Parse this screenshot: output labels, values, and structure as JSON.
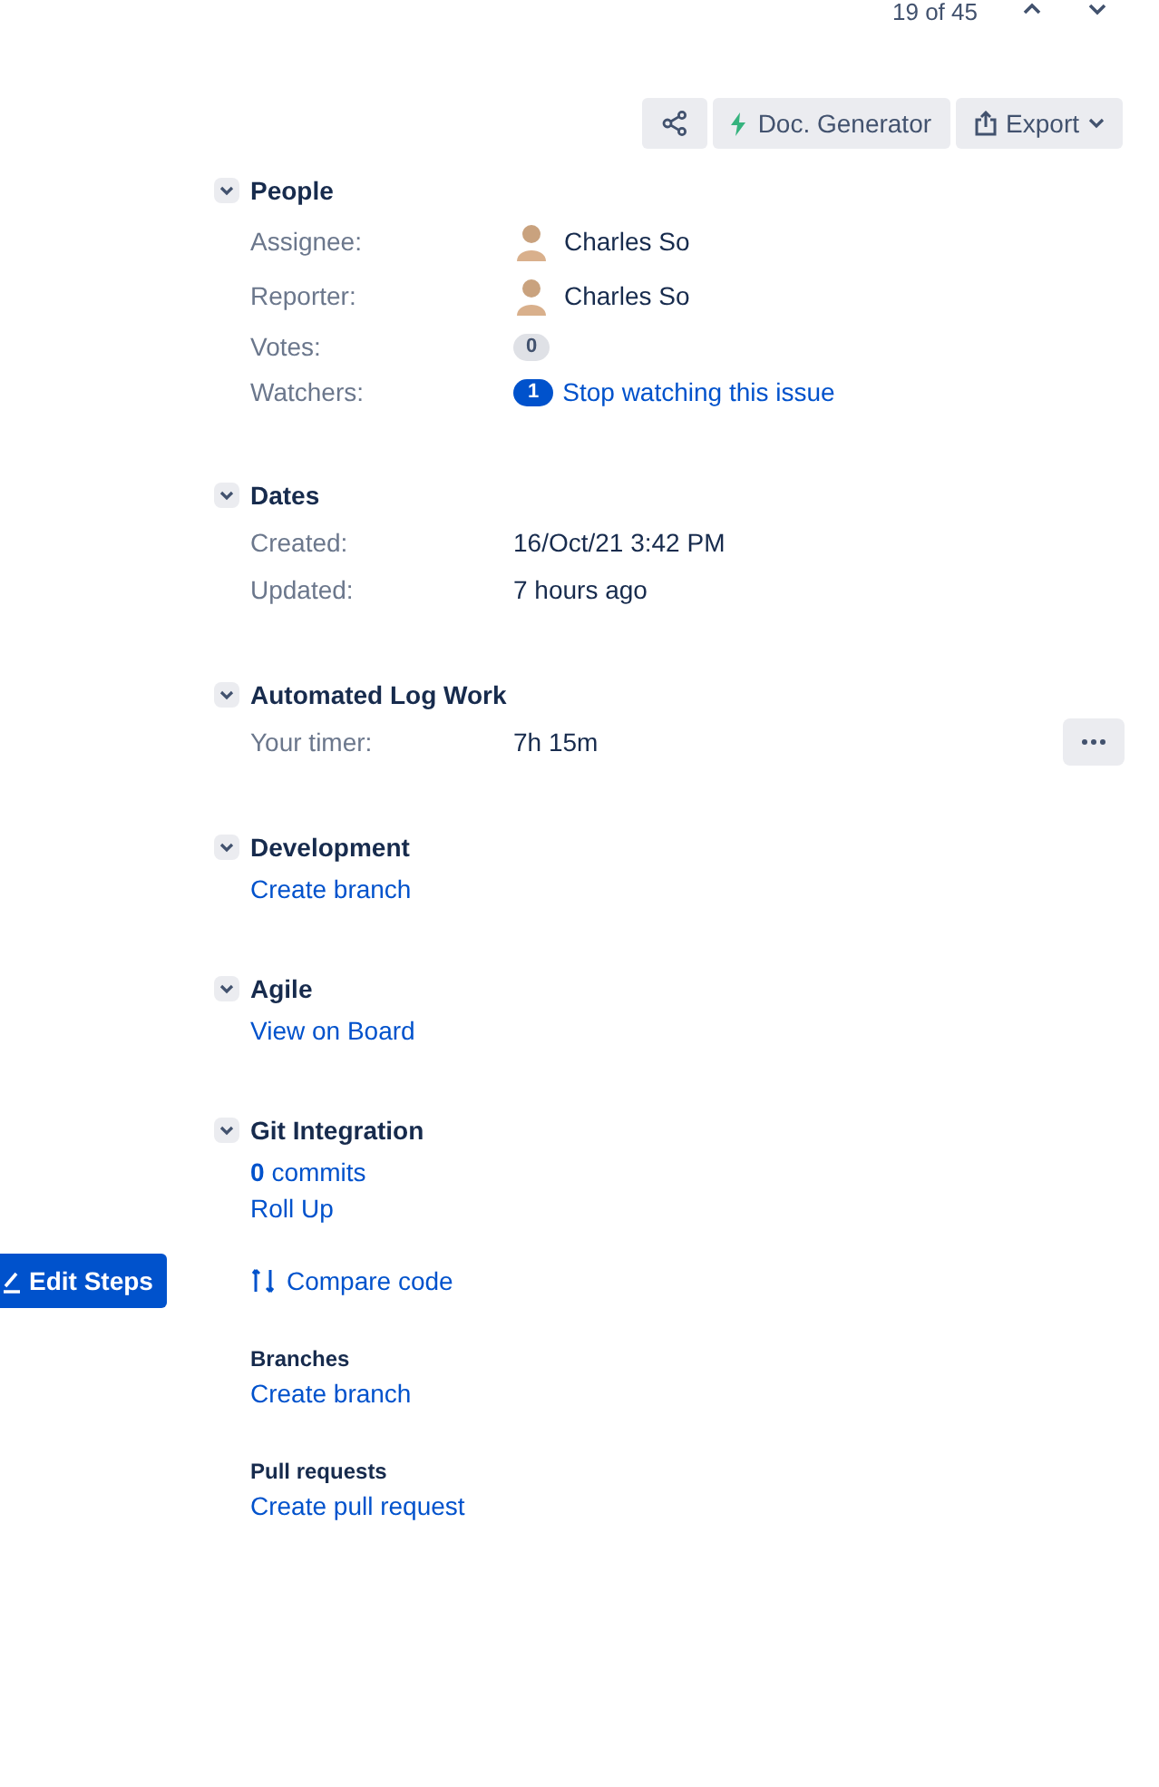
{
  "pager": {
    "text": "19 of 45"
  },
  "toolbar": {
    "buttons": [
      {
        "kind": "share"
      },
      {
        "kind": "generator",
        "label": "Doc. Generator"
      },
      {
        "kind": "export",
        "label": "Export"
      }
    ]
  },
  "edit_steps_button": {
    "label": "Edit Steps"
  },
  "sections": [
    {
      "title": "People",
      "expanded": true,
      "rows": [
        {
          "kind": "user_field",
          "label": "Assignee:",
          "value": "Charles So"
        },
        {
          "kind": "user_field",
          "label": "Reporter:",
          "value": "Charles So"
        },
        {
          "kind": "count_field",
          "label": "Votes:",
          "value": "0"
        },
        {
          "kind": "watch_field",
          "label": "Watchers:",
          "count": "1",
          "value": "Stop watching this issue"
        }
      ]
    },
    {
      "title": "Dates",
      "expanded": true,
      "rows": [
        {
          "kind": "text_field",
          "label": "Created:",
          "value": "16/Oct/21 3:42 PM"
        },
        {
          "kind": "text_field",
          "label": "Updated:",
          "value": "7 hours ago"
        }
      ]
    },
    {
      "title": "Automated Log Work",
      "expanded": true,
      "rows": [
        {
          "kind": "timer_field",
          "label": "Your timer:",
          "value": "7h 15m"
        }
      ]
    },
    {
      "title": "Development",
      "expanded": true,
      "rows": [
        {
          "kind": "link",
          "value": "Create branch"
        }
      ]
    },
    {
      "title": "Agile",
      "expanded": true,
      "rows": [
        {
          "kind": "link",
          "value": "View on Board"
        }
      ]
    },
    {
      "title": "Git Integration",
      "expanded": true,
      "rows": [
        {
          "kind": "commits",
          "count": "0",
          "value": "commits"
        },
        {
          "kind": "link",
          "value": "Roll Up"
        },
        {
          "kind": "compare_link",
          "value": "Compare code"
        },
        {
          "kind": "subheading",
          "value": "Branches"
        },
        {
          "kind": "link",
          "value": "Create branch"
        },
        {
          "kind": "subheading",
          "value": "Pull requests"
        },
        {
          "kind": "link",
          "value": "Create pull request"
        }
      ]
    }
  ]
}
